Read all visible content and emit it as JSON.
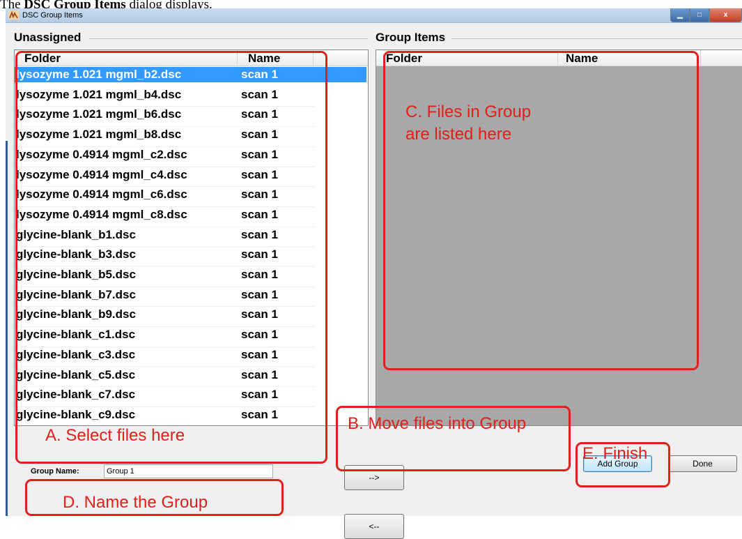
{
  "doc_caption": {
    "prefix": "The ",
    "bold": "DSC Group Items",
    "suffix": " dialog displays."
  },
  "window": {
    "title": "DSC Group Items",
    "controls": {
      "minimize": "▁",
      "maximize": "□",
      "close": "x"
    }
  },
  "unassigned": {
    "label": "Unassigned",
    "columns": {
      "folder": "Folder",
      "name": "Name"
    },
    "rows": [
      {
        "folder": "lysozyme 1.021 mgml_b2.dsc",
        "name": "scan 1",
        "selected": true
      },
      {
        "folder": "lysozyme 1.021 mgml_b4.dsc",
        "name": "scan 1"
      },
      {
        "folder": "lysozyme 1.021 mgml_b6.dsc",
        "name": "scan 1"
      },
      {
        "folder": "lysozyme 1.021 mgml_b8.dsc",
        "name": "scan 1"
      },
      {
        "folder": "lysozyme 0.4914 mgml_c2.dsc",
        "name": "scan 1"
      },
      {
        "folder": "lysozyme 0.4914 mgml_c4.dsc",
        "name": "scan 1"
      },
      {
        "folder": "lysozyme 0.4914 mgml_c6.dsc",
        "name": "scan 1"
      },
      {
        "folder": "lysozyme 0.4914 mgml_c8.dsc",
        "name": "scan 1"
      },
      {
        "folder": "glycine-blank_b1.dsc",
        "name": "scan 1"
      },
      {
        "folder": "glycine-blank_b3.dsc",
        "name": "scan 1"
      },
      {
        "folder": "glycine-blank_b5.dsc",
        "name": "scan 1"
      },
      {
        "folder": "glycine-blank_b7.dsc",
        "name": "scan 1"
      },
      {
        "folder": "glycine-blank_b9.dsc",
        "name": "scan 1"
      },
      {
        "folder": "glycine-blank_c1.dsc",
        "name": "scan 1"
      },
      {
        "folder": "glycine-blank_c3.dsc",
        "name": "scan 1"
      },
      {
        "folder": "glycine-blank_c5.dsc",
        "name": "scan 1"
      },
      {
        "folder": "glycine-blank_c7.dsc",
        "name": "scan 1"
      },
      {
        "folder": "glycine-blank_c9.dsc",
        "name": "scan 1"
      }
    ]
  },
  "group_items": {
    "label": "Group Items",
    "columns": {
      "folder": "Folder",
      "name": "Name"
    },
    "rows": []
  },
  "group_name": {
    "label": "Group Name:",
    "value": "Group 1"
  },
  "buttons": {
    "move_right": "-->",
    "move_left": "<--",
    "add_group": "Add Group",
    "done": "Done"
  },
  "annotations": {
    "a": "A. Select files here",
    "b": "B. Move files into Group",
    "c_line1": "C. Files in Group",
    "c_line2": "are listed here",
    "d": "D. Name the Group",
    "e": "E. Finish",
    "color": "#e0201a"
  },
  "colors": {
    "selection": "#3399ff",
    "empty_list": "#a8a8a8",
    "window_bg": "#f0f0f0"
  }
}
